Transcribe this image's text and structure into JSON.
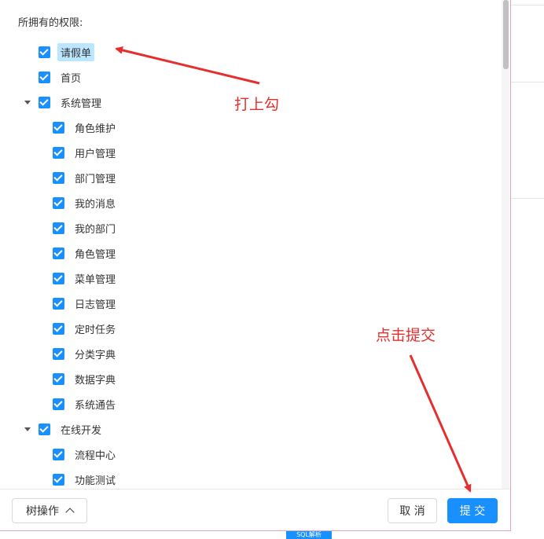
{
  "permissions": {
    "title": "所拥有的权限:",
    "items": [
      {
        "label": "请假单",
        "level": 0,
        "expandable": false,
        "selected": true
      },
      {
        "label": "首页",
        "level": 0,
        "expandable": false
      },
      {
        "label": "系统管理",
        "level": 0,
        "expandable": true
      },
      {
        "label": "角色维护",
        "level": 1
      },
      {
        "label": "用户管理",
        "level": 1
      },
      {
        "label": "部门管理",
        "level": 1
      },
      {
        "label": "我的消息",
        "level": 1
      },
      {
        "label": "我的部门",
        "level": 1
      },
      {
        "label": "角色管理",
        "level": 1
      },
      {
        "label": "菜单管理",
        "level": 1
      },
      {
        "label": "日志管理",
        "level": 1
      },
      {
        "label": "定时任务",
        "level": 1
      },
      {
        "label": "分类字典",
        "level": 1
      },
      {
        "label": "数据字典",
        "level": 1
      },
      {
        "label": "系统通告",
        "level": 1
      },
      {
        "label": "在线开发",
        "level": 0,
        "expandable": true
      },
      {
        "label": "流程中心",
        "level": 1
      },
      {
        "label": "功能测试",
        "level": 1
      }
    ]
  },
  "footer": {
    "tree_ops": "树操作",
    "cancel": "取 消",
    "submit": "提 交"
  },
  "annotations": {
    "check": "打上勾",
    "submit_hint": "点击提交",
    "color": "#e62e2e"
  },
  "bottom_tag": "SQL解析",
  "colors": {
    "primary": "#1890ff",
    "selected_bg": "#bae7ff"
  },
  "icons": {
    "checkbox": "checked-checkbox-icon",
    "caret": "caret-down-icon",
    "chevron": "chevron-up-icon"
  }
}
